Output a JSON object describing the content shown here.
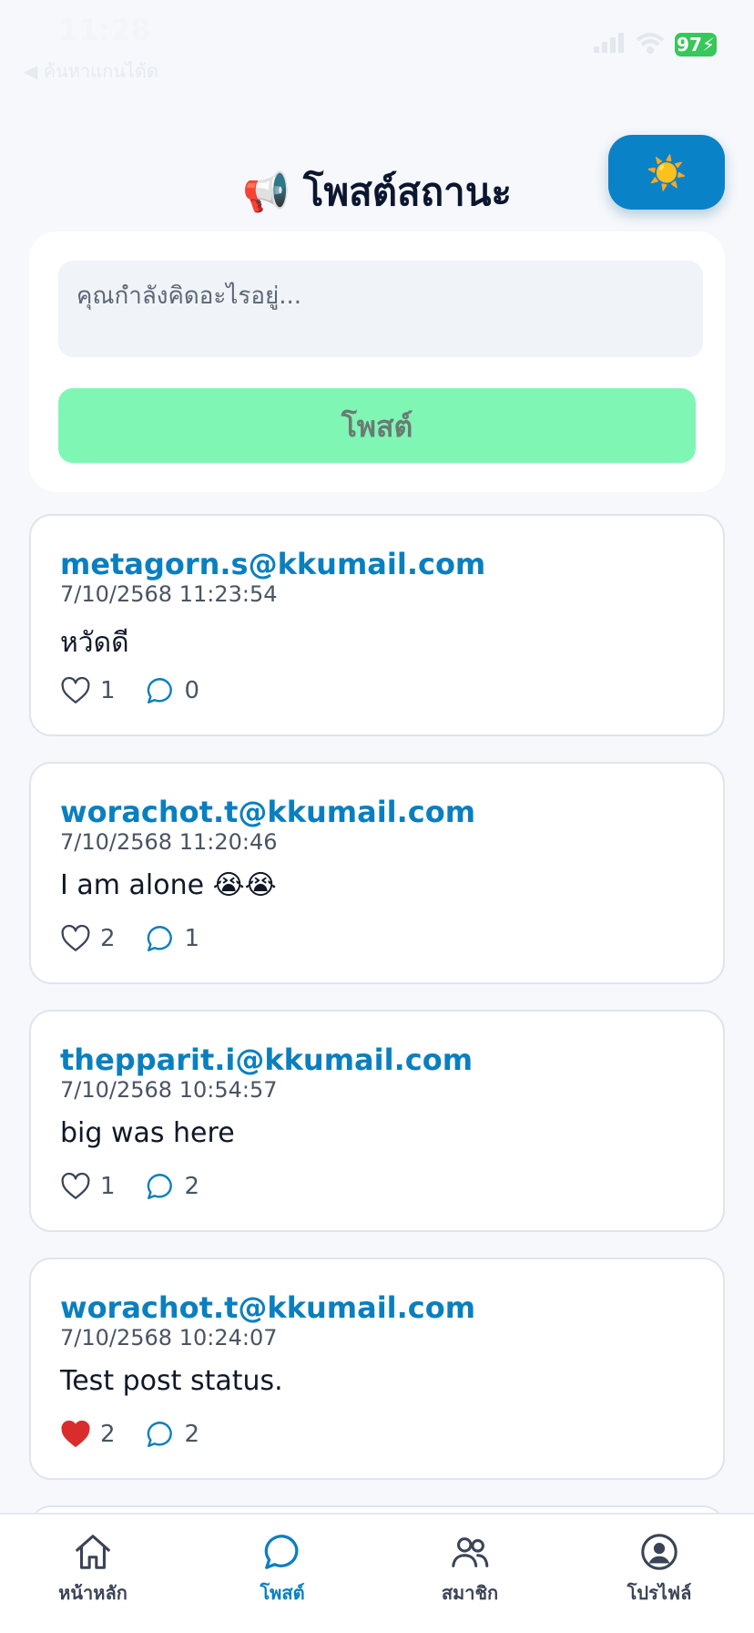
{
  "status_bar": {
    "time": "11:28",
    "back_label": "◀ ค้นหาแกนได้ด",
    "battery": "97"
  },
  "header": {
    "title": "📢 โพสต์สถานะ",
    "theme_icon": "☀️"
  },
  "composer": {
    "placeholder": "คุณกำลังคิดอะไรอยู่...",
    "post_label": "โพสต์"
  },
  "posts": [
    {
      "author": "metagorn.s@kkumail.com",
      "time": "7/10/2568 11:23:54",
      "body": "หวัดดี",
      "likes": "1",
      "comments": "0",
      "liked": false
    },
    {
      "author": "worachot.t@kkumail.com",
      "time": "7/10/2568 11:20:46",
      "body": "I am alone 😭😭",
      "likes": "2",
      "comments": "1",
      "liked": false
    },
    {
      "author": "thepparit.i@kkumail.com",
      "time": "7/10/2568 10:54:57",
      "body": "big was here",
      "likes": "1",
      "comments": "2",
      "liked": false
    },
    {
      "author": "worachot.t@kkumail.com",
      "time": "7/10/2568 10:24:07",
      "body": "Test post status.",
      "likes": "2",
      "comments": "2",
      "liked": true
    }
  ],
  "nav": {
    "items": [
      {
        "label": "หน้าหลัก",
        "icon": "home-icon"
      },
      {
        "label": "โพสต์",
        "icon": "chat-icon"
      },
      {
        "label": "สมาชิก",
        "icon": "users-icon"
      },
      {
        "label": "โปรไฟล์",
        "icon": "profile-icon"
      }
    ]
  },
  "colors": {
    "accent": "#0a7fc0",
    "post_button": "#80f6b4",
    "liked_heart": "#d92c2c"
  }
}
